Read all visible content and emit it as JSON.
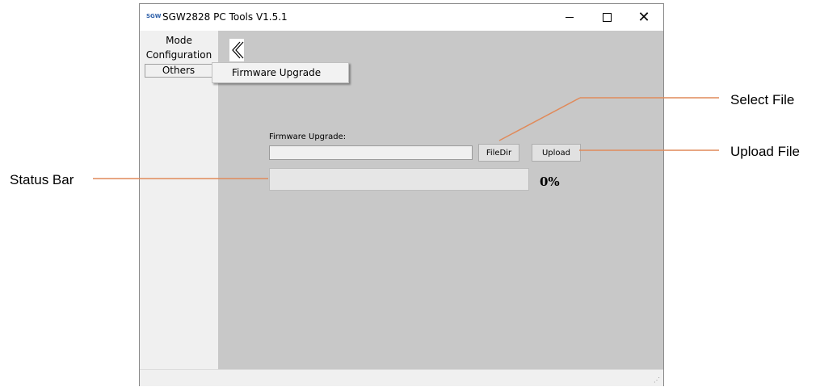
{
  "window": {
    "app_icon_text": "SGW",
    "title": "SGW2828 PC Tools V1.5.1",
    "minimize_glyph": "—",
    "close_glyph": "✕"
  },
  "sidebar": {
    "items": [
      {
        "label": "Mode"
      },
      {
        "label": "Configuration"
      },
      {
        "label": "Others"
      }
    ]
  },
  "submenu": {
    "items": [
      {
        "label": "Firmware Upgrade"
      }
    ]
  },
  "firmware": {
    "label": "Firmware Upgrade:",
    "file_path": "",
    "filedir_label": "FileDir",
    "upload_label": "Upload",
    "progress_percent": 0,
    "progress_text": "0%"
  },
  "icons": {
    "back": "double-chevron-left-icon",
    "resize_grip": "resize-grip-icon"
  },
  "callouts": {
    "select_file": "Select File",
    "upload_file": "Upload File",
    "status_bar": "Status Bar"
  },
  "colors": {
    "leader_line": "#e08a5a",
    "main_panel": "#c8c8c8",
    "window_bg": "#f0f0f0"
  }
}
